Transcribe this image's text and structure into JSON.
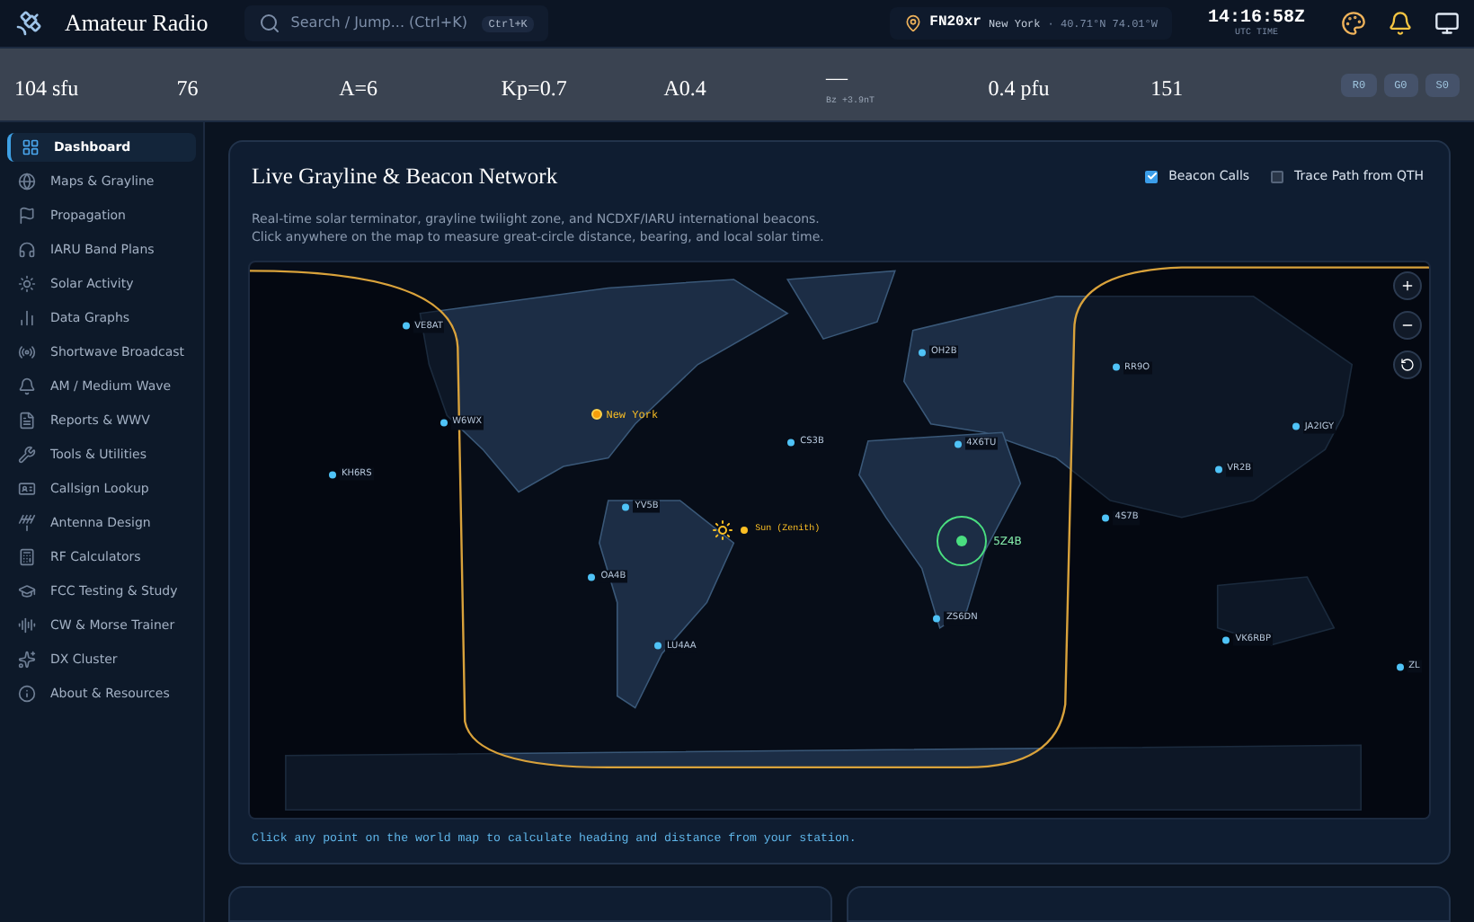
{
  "header": {
    "title": "Amateur Radio",
    "search_placeholder": "Search / Jump... (Ctrl+K)",
    "search_shortcut": "Ctrl+K",
    "location": {
      "grid": "FN20xr",
      "city": "New York",
      "coords": "· 40.71°N 74.01°W"
    },
    "time": "14:16:58Z",
    "time_label": "UTC TIME"
  },
  "stats": [
    {
      "kind": "value",
      "value": "104 sfu"
    },
    {
      "kind": "value",
      "value": "76"
    },
    {
      "kind": "value",
      "value": "A=6"
    },
    {
      "kind": "value",
      "value": "Kp=0.7"
    },
    {
      "kind": "value",
      "value": "A0.4"
    },
    {
      "kind": "value",
      "value": "—",
      "sub": "Bz +3.9nT"
    },
    {
      "kind": "value",
      "value": "0.4 pfu"
    },
    {
      "kind": "value",
      "value": "151"
    },
    {
      "kind": "badges",
      "badges": [
        "R0",
        "G0",
        "S0"
      ]
    }
  ],
  "sidebar": {
    "items": [
      {
        "label": "Dashboard",
        "selected": true
      },
      {
        "label": "Maps & Grayline",
        "selected": false
      },
      {
        "label": "Propagation",
        "selected": false
      },
      {
        "label": "IARU Band Plans",
        "selected": false
      },
      {
        "label": "Solar Activity",
        "selected": false
      },
      {
        "label": "Data Graphs",
        "selected": false
      },
      {
        "label": "Shortwave Broadcast",
        "selected": false
      },
      {
        "label": "AM / Medium Wave",
        "selected": false
      },
      {
        "label": "Reports & WWV",
        "selected": false
      },
      {
        "label": "Tools & Utilities",
        "selected": false
      },
      {
        "label": "Callsign Lookup",
        "selected": false
      },
      {
        "label": "Antenna Design",
        "selected": false
      },
      {
        "label": "RF Calculators",
        "selected": false
      },
      {
        "label": "FCC Testing & Study",
        "selected": false
      },
      {
        "label": "CW & Morse Trainer",
        "selected": false
      },
      {
        "label": "DX Cluster",
        "selected": false
      },
      {
        "label": "About & Resources",
        "selected": false
      }
    ]
  },
  "card": {
    "title": "Live Grayline & Beacon Network",
    "description": [
      "Real-time solar terminator, grayline twilight zone, and NCDXF/IARU international beacons.",
      "Click anywhere on the map to measure great-circle distance, bearing, and local solar time."
    ],
    "toggles": [
      {
        "label": "Beacon Calls",
        "checked": true
      },
      {
        "label": "Trace Path from QTH",
        "checked": false
      }
    ],
    "map": {
      "home": "New York",
      "sun": "Sun (Zenith)",
      "beacons": [
        {
          "call": "VE8AT",
          "selected": false
        },
        {
          "call": "W6WX",
          "selected": false
        },
        {
          "call": "KH6RS",
          "selected": false
        },
        {
          "call": "YV5B",
          "selected": false
        },
        {
          "call": "OA4B",
          "selected": false
        },
        {
          "call": "LU4AA",
          "selected": false
        },
        {
          "call": "CS3B",
          "selected": false
        },
        {
          "call": "OH2B",
          "selected": false
        },
        {
          "call": "4X6TU",
          "selected": false
        },
        {
          "call": "5Z4B",
          "selected": true
        },
        {
          "call": "ZS6DN",
          "selected": false
        },
        {
          "call": "RR9O",
          "selected": false
        },
        {
          "call": "JA2IGY",
          "selected": false
        },
        {
          "call": "VR2B",
          "selected": false
        },
        {
          "call": "4S7B",
          "selected": false
        },
        {
          "call": "VK6RBP",
          "selected": false
        },
        {
          "call": "ZL",
          "selected": false
        }
      ]
    },
    "hint": "Click any point on the world map to calculate heading and distance from your station."
  }
}
